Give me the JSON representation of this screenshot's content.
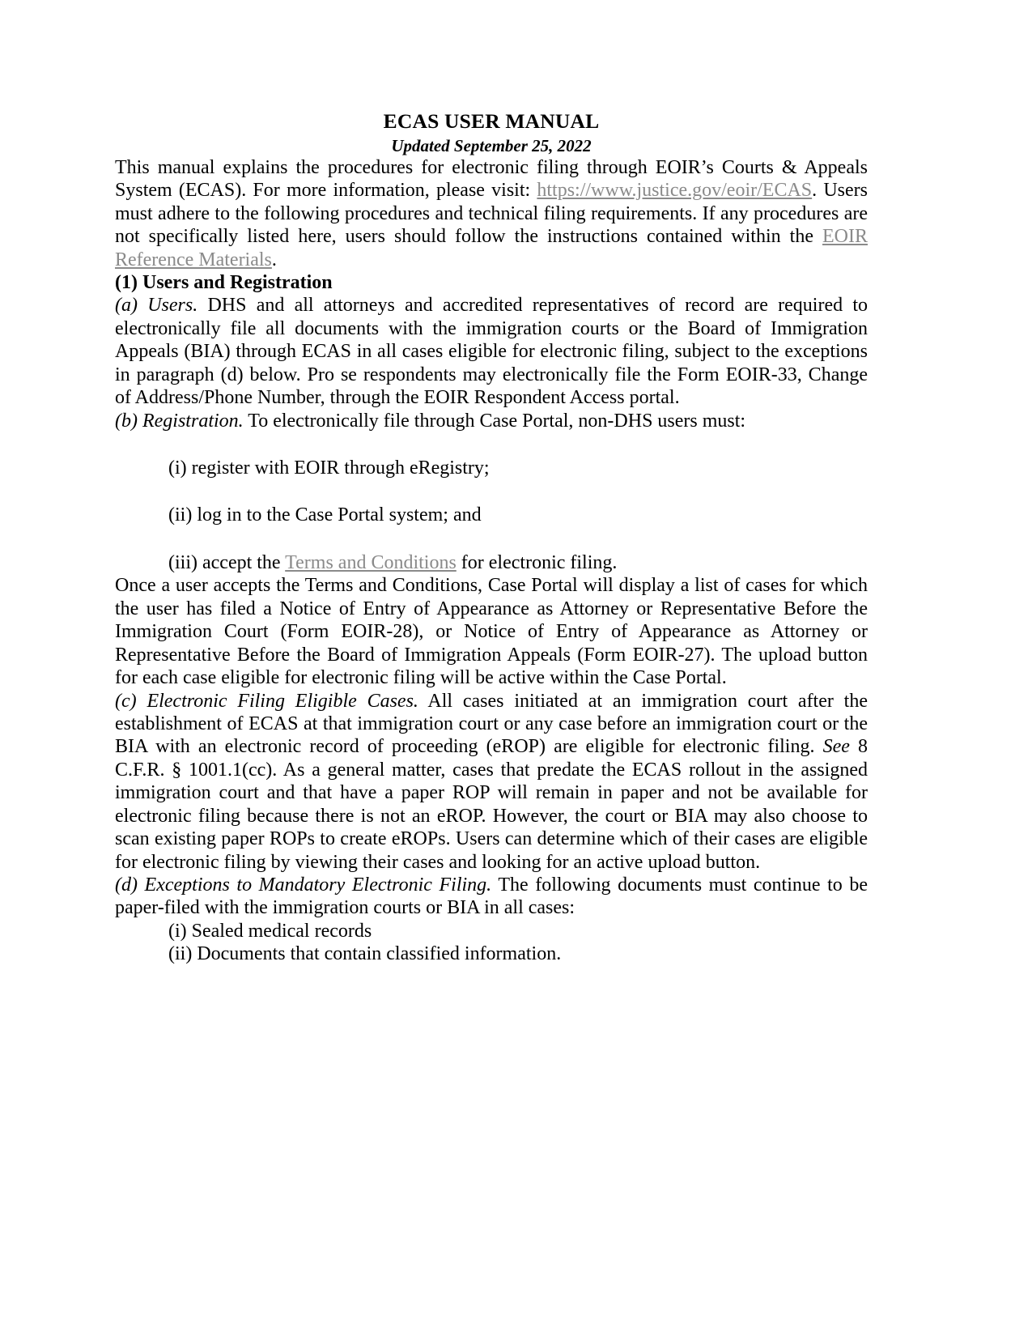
{
  "document": {
    "title": "ECAS USER MANUAL",
    "subtitle": "Updated September 25, 2022"
  },
  "intro": {
    "part1": "This manual explains the procedures for electronic filing through EOIR’s Courts & Appeals System (ECAS). For more information, please visit: ",
    "link1": "https://www.justice.gov/eoir/ECAS",
    "part2": ". Users must adhere to the following procedures and technical filing requirements. If any procedures are not specifically listed here, users should follow the instructions contained within the ",
    "link2": "EOIR Reference Materials",
    "part3": "."
  },
  "section1": {
    "heading": "(1) Users and Registration",
    "a": {
      "label": "(a) Users.",
      "text": " DHS and all attorneys and accredited representatives of record are required to electronically file all documents with the immigration courts or the Board of Immigration Appeals (BIA) through ECAS in all cases eligible for electronic filing, subject to the exceptions in paragraph (d) below. Pro se respondents may electronically file the Form EOIR-33, Change of Address/Phone Number, through the EOIR Respondent Access portal."
    },
    "b": {
      "label": "(b) Registration.",
      "text": " To electronically file through Case Portal, non-DHS users must:",
      "items": [
        {
          "text": "(i) register with EOIR through eRegistry;"
        },
        {
          "text": "(ii) log in to the Case Portal system; and"
        },
        {
          "prefix": "(iii) accept the ",
          "link": "Terms and Conditions",
          "suffix": " for electronic filing."
        }
      ],
      "after": "Once a user accepts the Terms and Conditions, Case Portal will display a list of cases for which the user has filed a Notice of Entry of Appearance as Attorney or Representative Before the Immigration Court (Form EOIR-28), or Notice of Entry of Appearance as Attorney or Representative Before the Board of Immigration Appeals (Form EOIR-27). The upload button for each case eligible for electronic filing will be active within the Case Portal."
    },
    "c": {
      "label": "(c) Electronic Filing Eligible Cases.",
      "text1": " All cases initiated at an immigration court after the establishment of ECAS at that immigration court or any case before an immigration court or the BIA with an electronic record of proceeding (eROP) are eligible for electronic filing. ",
      "cite_italic": "See",
      "text2": " 8 C.F.R. § 1001.1(cc). As a general matter, cases that predate the ECAS rollout in the assigned immigration court and that have a paper ROP will remain in paper and not be available for electronic filing because there is not an eROP. However, the court or BIA may also choose to scan existing paper ROPs to create eROPs. Users can determine which of their cases are eligible for electronic filing by viewing their cases and looking for an active upload button."
    },
    "d": {
      "label": "(d) Exceptions to Mandatory Electronic Filing.",
      "text": " The following documents must continue to be paper-filed with the immigration courts or BIA in all cases:",
      "items": [
        {
          "text": "(i) Sealed medical records"
        },
        {
          "text": "(ii) Documents that contain classified information."
        }
      ]
    }
  },
  "colors": {
    "link": "#8a8a8a",
    "text": "#000000",
    "background": "#ffffff"
  }
}
